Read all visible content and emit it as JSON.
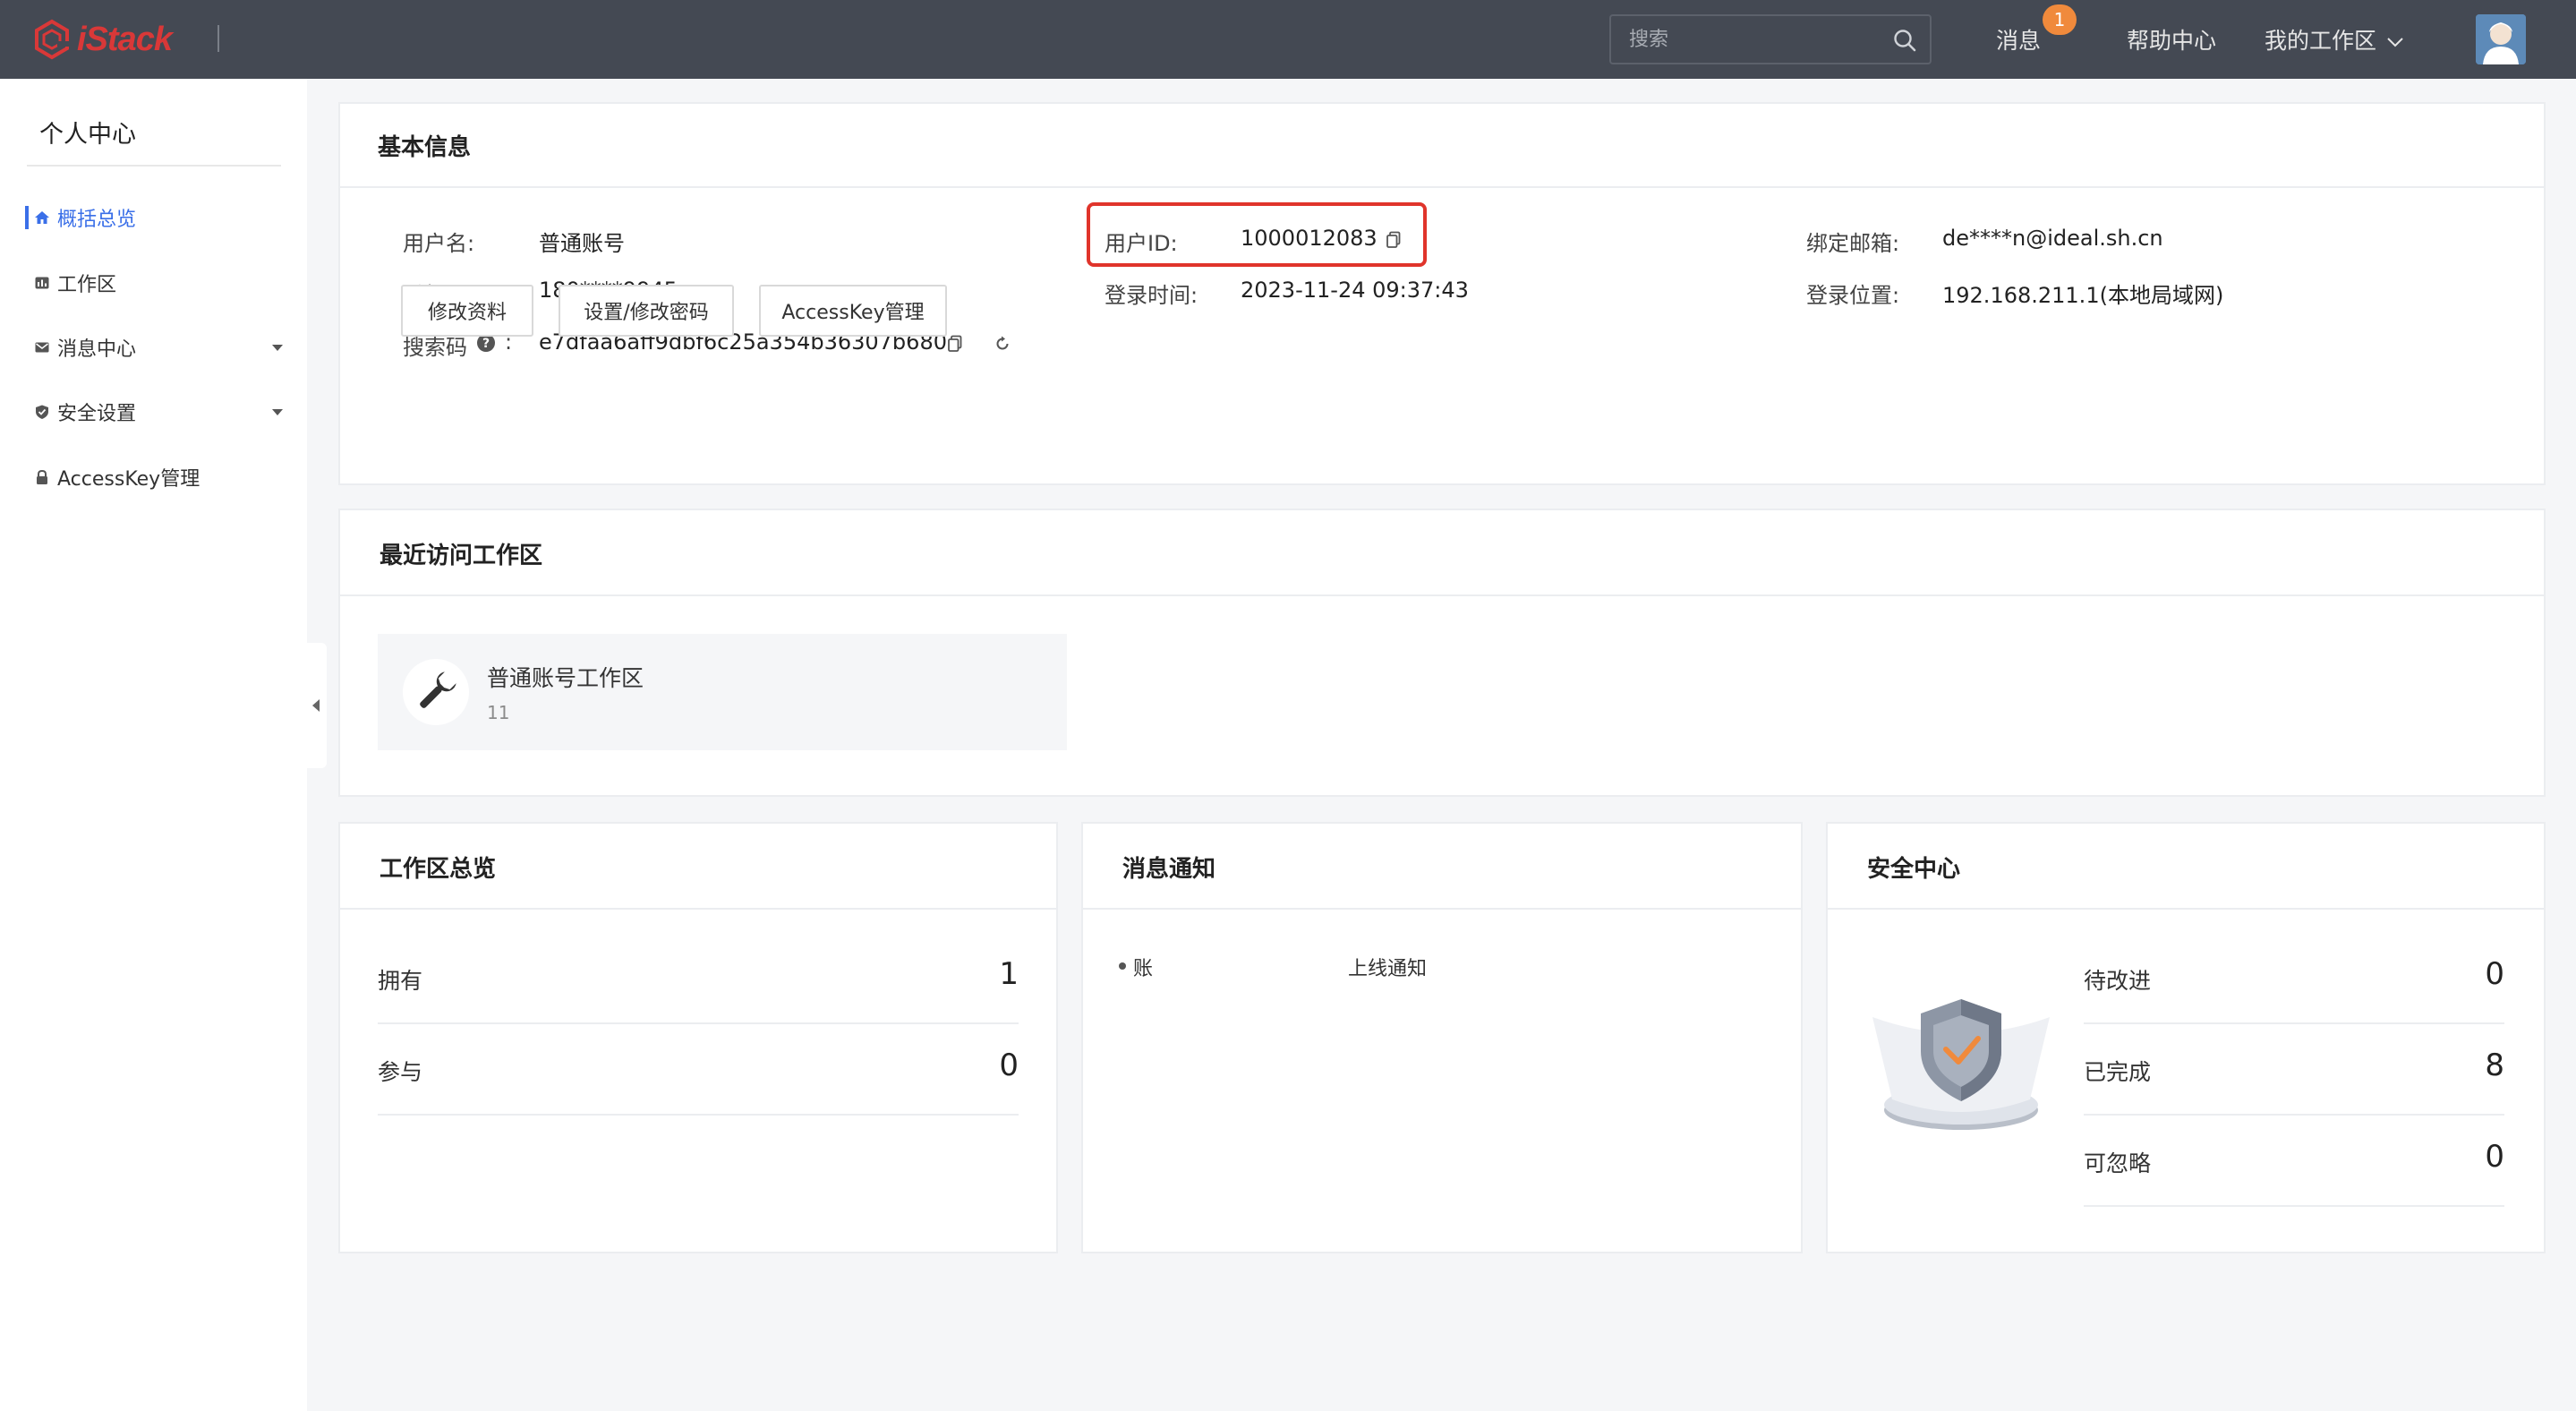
{
  "app": {
    "logo_text": "iStack"
  },
  "header": {
    "search_placeholder": "搜索",
    "messages_label": "消息",
    "messages_badge": "1",
    "help_label": "帮助中心",
    "workspace_label": "我的工作区"
  },
  "sidebar": {
    "title": "个人中心",
    "items": [
      {
        "label": "概括总览",
        "icon": "home-icon",
        "active": true
      },
      {
        "label": "工作区",
        "icon": "dashboard-icon"
      },
      {
        "label": "消息中心",
        "icon": "mail-icon",
        "expandable": true
      },
      {
        "label": "安全设置",
        "icon": "shield-icon",
        "expandable": true
      },
      {
        "label": "AccessKey管理",
        "icon": "lock-icon"
      }
    ]
  },
  "basic_info": {
    "title": "基本信息",
    "username_label": "用户名:",
    "username_value": "普通账号",
    "userid_label": "用户ID:",
    "userid_value": "1000012083",
    "email_label": "绑定邮箱:",
    "email_value": "de****n@ideal.sh.cn",
    "phone_label": "手机号码:",
    "phone_value": "180****9945",
    "login_time_label": "登录时间:",
    "login_time_value": "2023-11-24 09:37:43",
    "login_location_label": "登录位置:",
    "login_location_value": "192.168.211.1(本地局域网)",
    "search_code_label": "搜索码",
    "search_code_colon": ":",
    "search_code_value": "e7dfaa6aff9dbf6c25a354b36307b680",
    "buttons": [
      "修改资料",
      "设置/修改密码",
      "AccessKey管理"
    ]
  },
  "recent_workspaces": {
    "title": "最近访问工作区",
    "items": [
      {
        "name": "普通账号工作区",
        "count": "11"
      }
    ]
  },
  "workspace_overview": {
    "title": "工作区总览",
    "rows": [
      {
        "label": "拥有",
        "value": "1"
      },
      {
        "label": "参与",
        "value": "0"
      }
    ]
  },
  "notifications": {
    "title": "消息通知",
    "items": [
      {
        "prefix": "账",
        "text": "上线通知"
      }
    ]
  },
  "security_center": {
    "title": "安全中心",
    "rows": [
      {
        "label": "待改进",
        "value": "0"
      },
      {
        "label": "已完成",
        "value": "8"
      },
      {
        "label": "可忽略",
        "value": "0"
      }
    ]
  },
  "colors": {
    "accent": "#3a6fe8",
    "topbar": "#444953",
    "brand": "#d93838",
    "badge": "#f08a3c",
    "highlight": "#e0342b"
  }
}
